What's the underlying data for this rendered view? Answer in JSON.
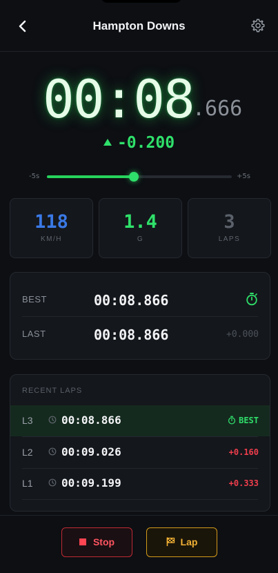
{
  "header": {
    "title": "Hampton Downs",
    "back_icon": "chevron-left-icon",
    "settings_icon": "gear-icon"
  },
  "timer": {
    "main": "00:08",
    "ms": ".666",
    "delta": "-0.200",
    "delta_icon": "triangle-up-icon"
  },
  "offset_slider": {
    "min_label": "-5s",
    "max_label": "+5s",
    "value_fraction": 0.47
  },
  "stats": [
    {
      "value": "118",
      "unit": "KM/H",
      "color": "#3a79e6"
    },
    {
      "value": "1.4",
      "unit": "G",
      "color": "#2fe06a"
    },
    {
      "value": "3",
      "unit": "LAPS",
      "color": "#5b616a"
    }
  ],
  "summary": {
    "best": {
      "label": "BEST",
      "time": "00:08.866",
      "icon": "stopwatch-icon"
    },
    "last": {
      "label": "LAST",
      "time": "00:08.866",
      "diff": "+0.000"
    }
  },
  "recent": {
    "title": "RECENT LAPS",
    "laps": [
      {
        "num": "L3",
        "time": "00:08.866",
        "diff": "BEST",
        "best": true
      },
      {
        "num": "L2",
        "time": "00:09.026",
        "diff": "+0.160",
        "best": false
      },
      {
        "num": "L1",
        "time": "00:09.199",
        "diff": "+0.333",
        "best": false
      }
    ]
  },
  "actions": {
    "stop_label": "Stop",
    "lap_label": "Lap"
  },
  "colors": {
    "accent_green": "#2fe06a",
    "danger_red": "#ff4452",
    "warning_amber": "#f2b134",
    "speed_blue": "#3a79e6"
  }
}
